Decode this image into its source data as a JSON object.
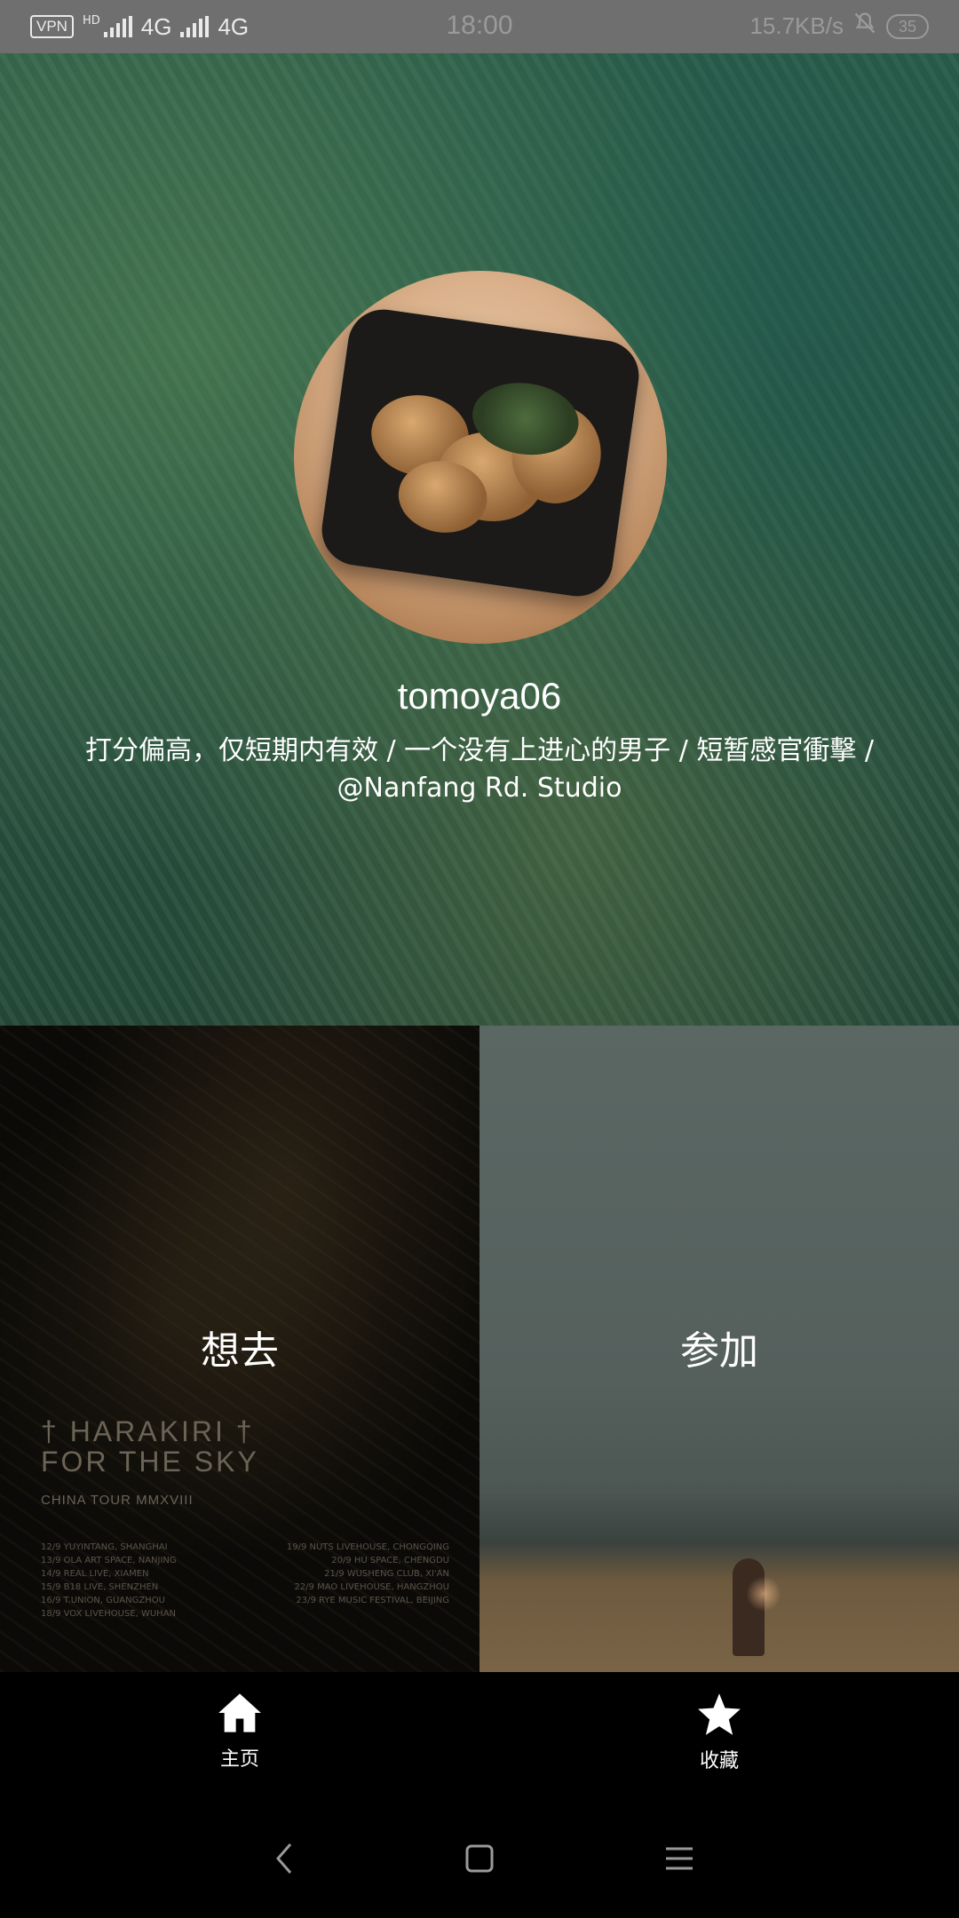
{
  "status_bar": {
    "vpn": "VPN",
    "hd": "HD",
    "net1": "4G",
    "net2": "4G",
    "time": "18:00",
    "speed": "15.7KB/s",
    "battery": "35"
  },
  "profile": {
    "username": "tomoya06",
    "bio_line1": "打分偏高，仅短期内有效 / 一个没有上进心的男子 / 短暂感官衝擊 /",
    "bio_line2": "@Nanfang Rd. Studio"
  },
  "panels": {
    "want": {
      "label": "想去"
    },
    "attend": {
      "label": "参加"
    }
  },
  "poster": {
    "title_line1": "† HARAKIRI †",
    "title_line2": "FOR THE SKY",
    "subtitle": "CHINA TOUR MMXVIII",
    "dates": [
      [
        "12/9 YUYINTANG, SHANGHAI",
        "19/9 NUTS LIVEHOUSE, CHONGQING"
      ],
      [
        "13/9 OLA ART SPACE, NANJING",
        "20/9 HU SPACE, CHENGDU"
      ],
      [
        "14/9 REAL LIVE, XIAMEN",
        "21/9 WUSHENG CLUB, XI'AN"
      ],
      [
        "15/9 B18 LIVE, SHENZHEN",
        "22/9 MAO LIVEHOUSE, HANGZHOU"
      ],
      [
        "16/9 T.UNION, GUANGZHOU",
        "23/9 RYE MUSIC FESTIVAL, BEIJING"
      ],
      [
        "18/9 VOX LIVEHOUSE, WUHAN",
        ""
      ]
    ]
  },
  "bottom_nav": {
    "home_label": "主页",
    "fav_label": "收藏"
  }
}
